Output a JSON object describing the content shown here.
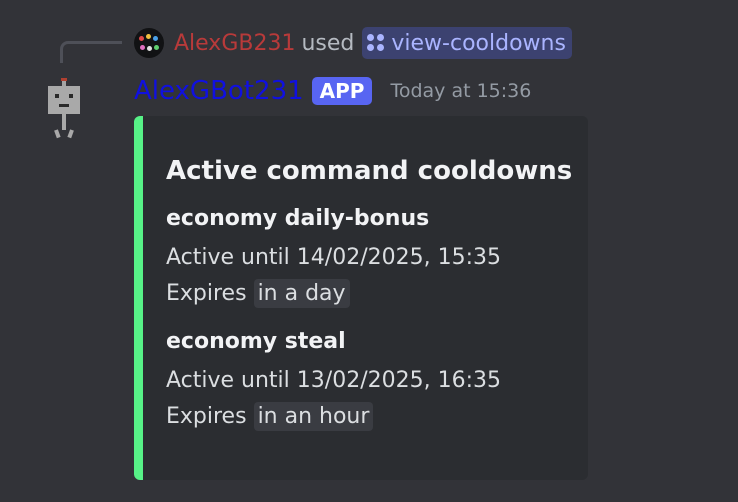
{
  "reply": {
    "username": "AlexGB231",
    "action_text": "used",
    "command": "view-cooldowns",
    "command_icon": "slash-command-icon",
    "avatar_icon": "user-avatar-icon"
  },
  "message": {
    "bot_name": "AlexGBot231",
    "badge": "APP",
    "timestamp": "Today at 15:36",
    "avatar_icon": "robot-avatar-icon"
  },
  "embed": {
    "accent_color": "#57f287",
    "title": "Active command cooldowns",
    "fields": [
      {
        "name": "economy daily-bonus",
        "active_prefix": "Active until",
        "active_until": "14/02/2025, 15:35",
        "expires_prefix": "Expires",
        "expires_relative": "in a day"
      },
      {
        "name": "economy steal",
        "active_prefix": "Active until",
        "active_until": "13/02/2025, 16:35",
        "expires_prefix": "Expires",
        "expires_relative": "in an hour"
      }
    ]
  },
  "colors": {
    "background": "#323338",
    "embed_background": "#2b2d31",
    "reply_username": "#b83a3a",
    "bot_name": "#1010e0",
    "app_badge": "#5865f2",
    "command_chip": "#3c4270"
  }
}
